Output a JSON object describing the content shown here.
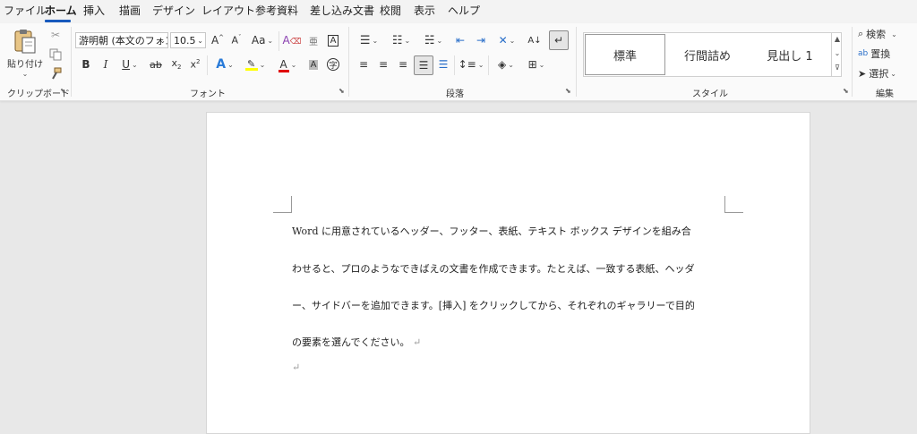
{
  "tabs": [
    {
      "label": "ファイル"
    },
    {
      "label": "ホーム"
    },
    {
      "label": "挿入"
    },
    {
      "label": "描画"
    },
    {
      "label": "デザイン"
    },
    {
      "label": "レイアウト"
    },
    {
      "label": "参考資料"
    },
    {
      "label": "差し込み文書"
    },
    {
      "label": "校閲"
    },
    {
      "label": "表示"
    },
    {
      "label": "ヘルプ"
    }
  ],
  "active_tab": "ホーム",
  "clipboard": {
    "paste_label": "貼り付け",
    "group_label": "クリップボード"
  },
  "font": {
    "name": "游明朝 (本文のフォン",
    "size": "10.5",
    "group_label": "フォント"
  },
  "paragraph": {
    "group_label": "段落"
  },
  "styles": {
    "items": [
      {
        "label": "標準"
      },
      {
        "label": "行間詰め"
      },
      {
        "label": "見出し 1"
      }
    ],
    "selected": "標準",
    "group_label": "スタイル"
  },
  "editing": {
    "search_label": "検索",
    "replace_label": "置換",
    "select_label": "選択",
    "group_label": "編集"
  },
  "document": {
    "lines": [
      "Word に用意されているヘッダー、フッター、表紙、テキスト ボックス デザインを組み合",
      "わせると、プロのようなできばえの文書を作成できます。たとえば、一致する表紙、ヘッダ",
      "ー、サイドバーを追加できます。[挿入] をクリックしてから、それぞれのギャラリーで目的",
      "の要素を選んでください。"
    ],
    "paragraph_mark": "↵"
  },
  "colors": {
    "accent": "#185abd",
    "highlight": "#ffff00",
    "font_color": "#e00000"
  }
}
